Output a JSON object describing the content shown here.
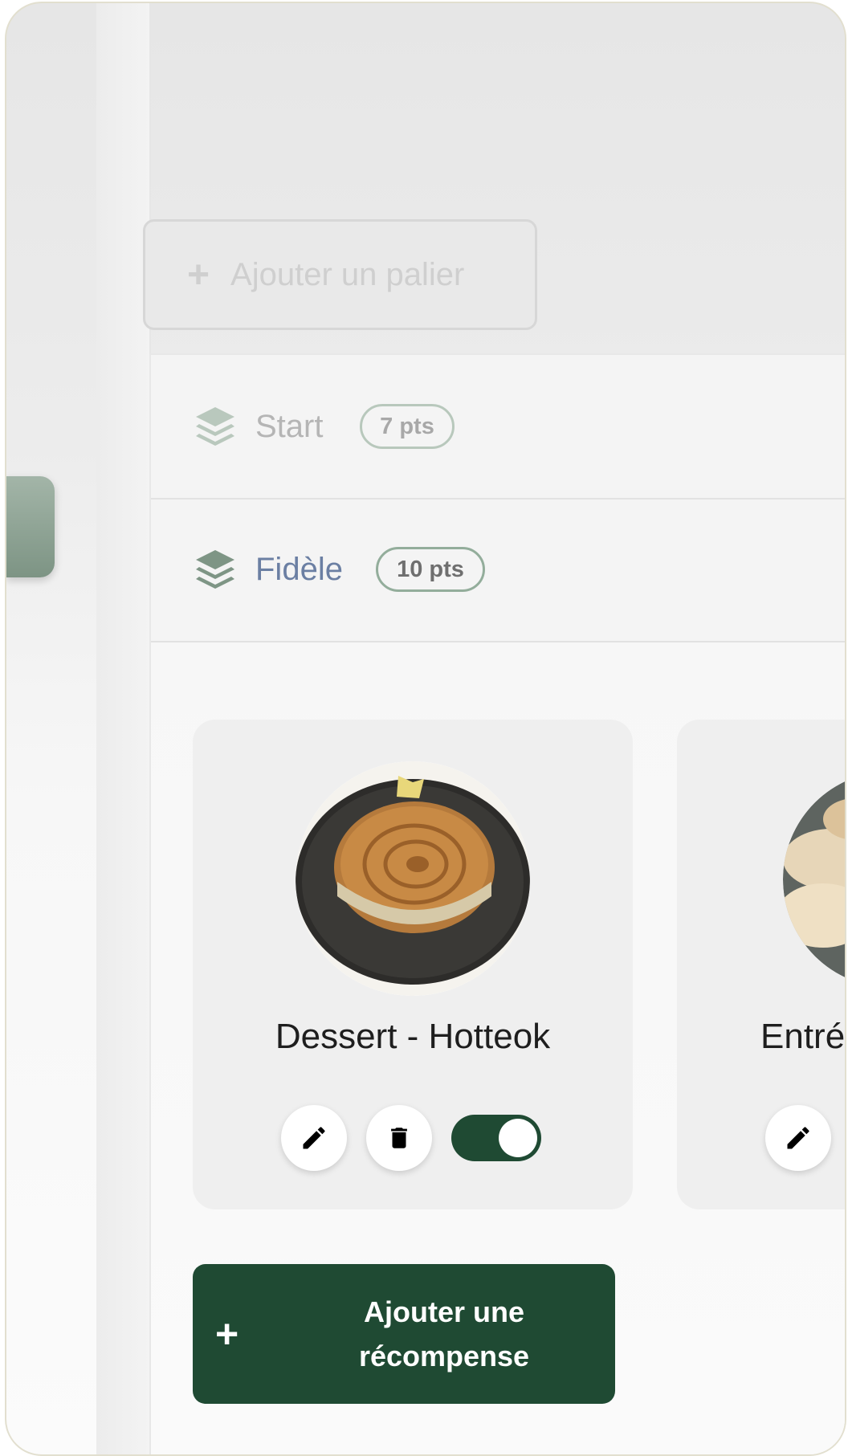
{
  "toolbar": {
    "add_tier_label": "Ajouter un palier",
    "add_tier_icon": "plus-icon"
  },
  "tiers": [
    {
      "name": "Start",
      "points": "7 pts",
      "icon": "layers-icon"
    },
    {
      "name": "Fidèle",
      "points": "10 pts",
      "icon": "layers-icon"
    }
  ],
  "rewards": [
    {
      "title": "Dessert - Hotteok",
      "image": "hotteok-photo",
      "active": true
    },
    {
      "title": "Entré",
      "image": "dumplings-photo"
    }
  ],
  "actions": {
    "add_reward_label": "Ajouter une récompense",
    "add_reward_icon": "plus-icon"
  },
  "colors": {
    "brand_dark_green": "#1f4a33",
    "badge_border": "#93ad9b",
    "start_label": "#b5b5b5",
    "fidele_label": "#6b7fa3",
    "side_tab": "#8aa091"
  }
}
